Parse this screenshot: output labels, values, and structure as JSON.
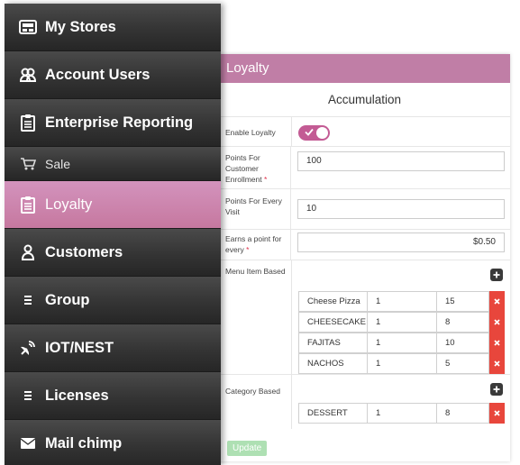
{
  "sidebar": {
    "items": [
      {
        "label": "My Stores",
        "icon": "store-icon"
      },
      {
        "label": "Account Users",
        "icon": "users-icon"
      },
      {
        "label": "Enterprise Reporting",
        "icon": "clipboard-icon"
      },
      {
        "label": "Sale",
        "icon": "cart-icon"
      },
      {
        "label": "Loyalty",
        "icon": "clipboard-icon",
        "active": true
      },
      {
        "label": "Customers",
        "icon": "user-icon"
      },
      {
        "label": "Group",
        "icon": "list-icon"
      },
      {
        "label": "IOT/NEST",
        "icon": "satellite-icon"
      },
      {
        "label": "Licenses",
        "icon": "list-icon"
      },
      {
        "label": "Mail chimp",
        "icon": "envelope-icon"
      }
    ]
  },
  "panel": {
    "title": "Loyalty",
    "subtitle": "Accumulation",
    "enable_label": "Enable Loyalty",
    "enable_value": true,
    "enrollment_label": "Points For Customer Enrollment",
    "enrollment_value": "100",
    "visit_label": "Points For Every Visit",
    "visit_value": "10",
    "earns_label": "Earns a point for every",
    "earns_value": "$0.50",
    "menu_label": "Menu Item Based",
    "menu_items": [
      {
        "name": "Cheese Pizza",
        "qty": "1",
        "points": "15"
      },
      {
        "name": "CHEESECAKE",
        "qty": "1",
        "points": "8"
      },
      {
        "name": "FAJITAS",
        "qty": "1",
        "points": "10"
      },
      {
        "name": "NACHOS",
        "qty": "1",
        "points": "5"
      }
    ],
    "category_label": "Category Based",
    "category_items": [
      {
        "name": "DESSERT",
        "qty": "1",
        "points": "8"
      }
    ],
    "update_label": "Update"
  },
  "colors": {
    "accent": "#c07ea6",
    "toggle": "#c35b94",
    "delete": "#e8463c",
    "update": "#aee0b3"
  }
}
